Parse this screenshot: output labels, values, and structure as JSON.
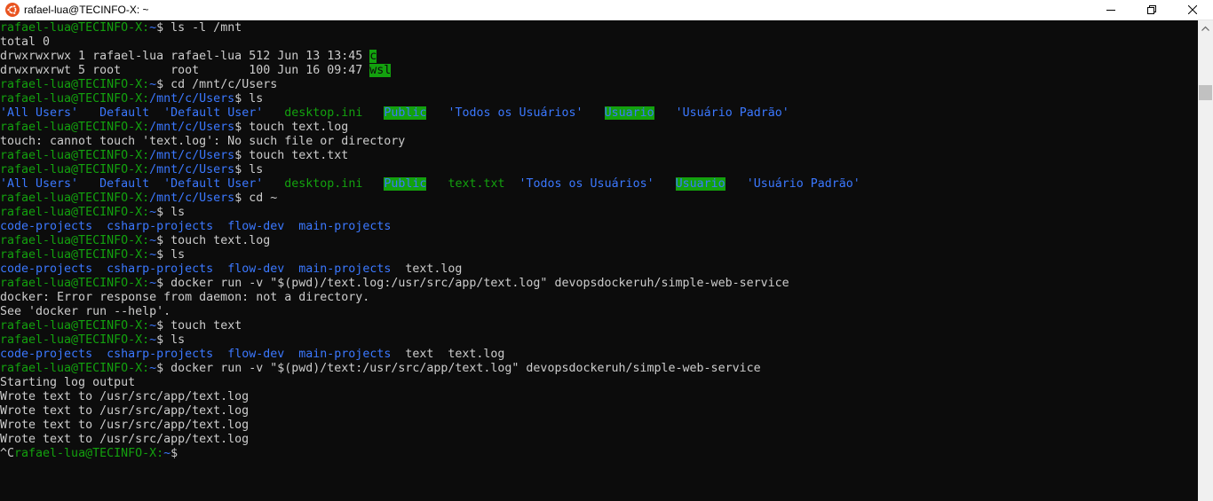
{
  "window": {
    "title": "rafael-lua@TECINFO-X: ~"
  },
  "colors": {
    "prompt_user": "#13a10e",
    "prompt_path": "#3b78ff",
    "text": "#cccccc",
    "background": "#0c0c0c"
  },
  "terminal": {
    "lines": [
      [
        {
          "t": "rafael-lua@TECINFO-X:",
          "c": "prompt-user"
        },
        {
          "t": "~",
          "c": "prompt-path"
        },
        {
          "t": "$ ls -l /mnt",
          "c": ""
        }
      ],
      [
        {
          "t": "total 0",
          "c": ""
        }
      ],
      [
        {
          "t": "drwxrwxrwx 1 rafael-lua rafael-lua 512 Jun 13 13:45 ",
          "c": ""
        },
        {
          "t": "c",
          "c": "sticky"
        }
      ],
      [
        {
          "t": "drwxrwxrwt 5 root       root       100 Jun 16 09:47 ",
          "c": ""
        },
        {
          "t": "wsl",
          "c": "sticky"
        }
      ],
      [
        {
          "t": "rafael-lua@TECINFO-X:",
          "c": "prompt-user"
        },
        {
          "t": "~",
          "c": "prompt-path"
        },
        {
          "t": "$ cd /mnt/c/Users",
          "c": ""
        }
      ],
      [
        {
          "t": "rafael-lua@TECINFO-X:",
          "c": "prompt-user"
        },
        {
          "t": "/mnt/c/Users",
          "c": "prompt-path"
        },
        {
          "t": "$ ls",
          "c": ""
        }
      ],
      [
        {
          "t": "'All Users'",
          "c": "dir"
        },
        {
          "t": "   ",
          "c": ""
        },
        {
          "t": "Default",
          "c": "dir"
        },
        {
          "t": "  ",
          "c": ""
        },
        {
          "t": "'Default User'",
          "c": "dir"
        },
        {
          "t": "   ",
          "c": ""
        },
        {
          "t": "desktop.ini",
          "c": "prompt-user"
        },
        {
          "t": "   ",
          "c": ""
        },
        {
          "t": "Public",
          "c": "other-w"
        },
        {
          "t": "   ",
          "c": ""
        },
        {
          "t": "'Todos os Usuários'",
          "c": "dir"
        },
        {
          "t": "   ",
          "c": ""
        },
        {
          "t": "Usuario",
          "c": "other-w"
        },
        {
          "t": "   ",
          "c": ""
        },
        {
          "t": "'Usuário Padrão'",
          "c": "dir"
        }
      ],
      [
        {
          "t": "rafael-lua@TECINFO-X:",
          "c": "prompt-user"
        },
        {
          "t": "/mnt/c/Users",
          "c": "prompt-path"
        },
        {
          "t": "$ touch text.log",
          "c": ""
        }
      ],
      [
        {
          "t": "touch: cannot touch 'text.log': No such file or directory",
          "c": ""
        }
      ],
      [
        {
          "t": "rafael-lua@TECINFO-X:",
          "c": "prompt-user"
        },
        {
          "t": "/mnt/c/Users",
          "c": "prompt-path"
        },
        {
          "t": "$ touch text.txt",
          "c": ""
        }
      ],
      [
        {
          "t": "rafael-lua@TECINFO-X:",
          "c": "prompt-user"
        },
        {
          "t": "/mnt/c/Users",
          "c": "prompt-path"
        },
        {
          "t": "$ ls",
          "c": ""
        }
      ],
      [
        {
          "t": "'All Users'",
          "c": "dir"
        },
        {
          "t": "   ",
          "c": ""
        },
        {
          "t": "Default",
          "c": "dir"
        },
        {
          "t": "  ",
          "c": ""
        },
        {
          "t": "'Default User'",
          "c": "dir"
        },
        {
          "t": "   ",
          "c": ""
        },
        {
          "t": "desktop.ini",
          "c": "prompt-user"
        },
        {
          "t": "   ",
          "c": ""
        },
        {
          "t": "Public",
          "c": "other-w"
        },
        {
          "t": "   ",
          "c": ""
        },
        {
          "t": "text.txt",
          "c": "prompt-user"
        },
        {
          "t": "  ",
          "c": ""
        },
        {
          "t": "'Todos os Usuários'",
          "c": "dir"
        },
        {
          "t": "   ",
          "c": ""
        },
        {
          "t": "Usuario",
          "c": "other-w"
        },
        {
          "t": "   ",
          "c": ""
        },
        {
          "t": "'Usuário Padrão'",
          "c": "dir"
        }
      ],
      [
        {
          "t": "rafael-lua@TECINFO-X:",
          "c": "prompt-user"
        },
        {
          "t": "/mnt/c/Users",
          "c": "prompt-path"
        },
        {
          "t": "$ cd ~",
          "c": ""
        }
      ],
      [
        {
          "t": "rafael-lua@TECINFO-X:",
          "c": "prompt-user"
        },
        {
          "t": "~",
          "c": "prompt-path"
        },
        {
          "t": "$ ls",
          "c": ""
        }
      ],
      [
        {
          "t": "code-projects",
          "c": "dir"
        },
        {
          "t": "  ",
          "c": ""
        },
        {
          "t": "csharp-projects",
          "c": "dir"
        },
        {
          "t": "  ",
          "c": ""
        },
        {
          "t": "flow-dev",
          "c": "dir"
        },
        {
          "t": "  ",
          "c": ""
        },
        {
          "t": "main-projects",
          "c": "dir"
        }
      ],
      [
        {
          "t": "rafael-lua@TECINFO-X:",
          "c": "prompt-user"
        },
        {
          "t": "~",
          "c": "prompt-path"
        },
        {
          "t": "$ touch text.log",
          "c": ""
        }
      ],
      [
        {
          "t": "rafael-lua@TECINFO-X:",
          "c": "prompt-user"
        },
        {
          "t": "~",
          "c": "prompt-path"
        },
        {
          "t": "$ ls",
          "c": ""
        }
      ],
      [
        {
          "t": "code-projects",
          "c": "dir"
        },
        {
          "t": "  ",
          "c": ""
        },
        {
          "t": "csharp-projects",
          "c": "dir"
        },
        {
          "t": "  ",
          "c": ""
        },
        {
          "t": "flow-dev",
          "c": "dir"
        },
        {
          "t": "  ",
          "c": ""
        },
        {
          "t": "main-projects",
          "c": "dir"
        },
        {
          "t": "  text.log",
          "c": ""
        }
      ],
      [
        {
          "t": "rafael-lua@TECINFO-X:",
          "c": "prompt-user"
        },
        {
          "t": "~",
          "c": "prompt-path"
        },
        {
          "t": "$ docker run -v \"$(pwd)/text.log:/usr/src/app/text.log\" devopsdockeruh/simple-web-service",
          "c": ""
        }
      ],
      [
        {
          "t": "docker: Error response from daemon: not a directory.",
          "c": ""
        }
      ],
      [
        {
          "t": "See 'docker run --help'.",
          "c": ""
        }
      ],
      [
        {
          "t": "rafael-lua@TECINFO-X:",
          "c": "prompt-user"
        },
        {
          "t": "~",
          "c": "prompt-path"
        },
        {
          "t": "$ touch text",
          "c": ""
        }
      ],
      [
        {
          "t": "rafael-lua@TECINFO-X:",
          "c": "prompt-user"
        },
        {
          "t": "~",
          "c": "prompt-path"
        },
        {
          "t": "$ ls",
          "c": ""
        }
      ],
      [
        {
          "t": "code-projects",
          "c": "dir"
        },
        {
          "t": "  ",
          "c": ""
        },
        {
          "t": "csharp-projects",
          "c": "dir"
        },
        {
          "t": "  ",
          "c": ""
        },
        {
          "t": "flow-dev",
          "c": "dir"
        },
        {
          "t": "  ",
          "c": ""
        },
        {
          "t": "main-projects",
          "c": "dir"
        },
        {
          "t": "  text  text.log",
          "c": ""
        }
      ],
      [
        {
          "t": "rafael-lua@TECINFO-X:",
          "c": "prompt-user"
        },
        {
          "t": "~",
          "c": "prompt-path"
        },
        {
          "t": "$ docker run -v \"$(pwd)/text:/usr/src/app/text.log\" devopsdockeruh/simple-web-service",
          "c": ""
        }
      ],
      [
        {
          "t": "Starting log output",
          "c": ""
        }
      ],
      [
        {
          "t": "Wrote text to /usr/src/app/text.log",
          "c": ""
        }
      ],
      [
        {
          "t": "Wrote text to /usr/src/app/text.log",
          "c": ""
        }
      ],
      [
        {
          "t": "Wrote text to /usr/src/app/text.log",
          "c": ""
        }
      ],
      [
        {
          "t": "Wrote text to /usr/src/app/text.log",
          "c": ""
        }
      ],
      [
        {
          "t": "^C",
          "c": ""
        },
        {
          "t": "rafael-lua@TECINFO-X:",
          "c": "prompt-user"
        },
        {
          "t": "~",
          "c": "prompt-path"
        },
        {
          "t": "$",
          "c": ""
        }
      ]
    ]
  },
  "icons": {
    "app": "ubuntu-icon",
    "minimize": "minimize-icon",
    "maximize": "maximize-icon",
    "close": "close-icon",
    "scroll_up": "chevron-up-icon"
  }
}
